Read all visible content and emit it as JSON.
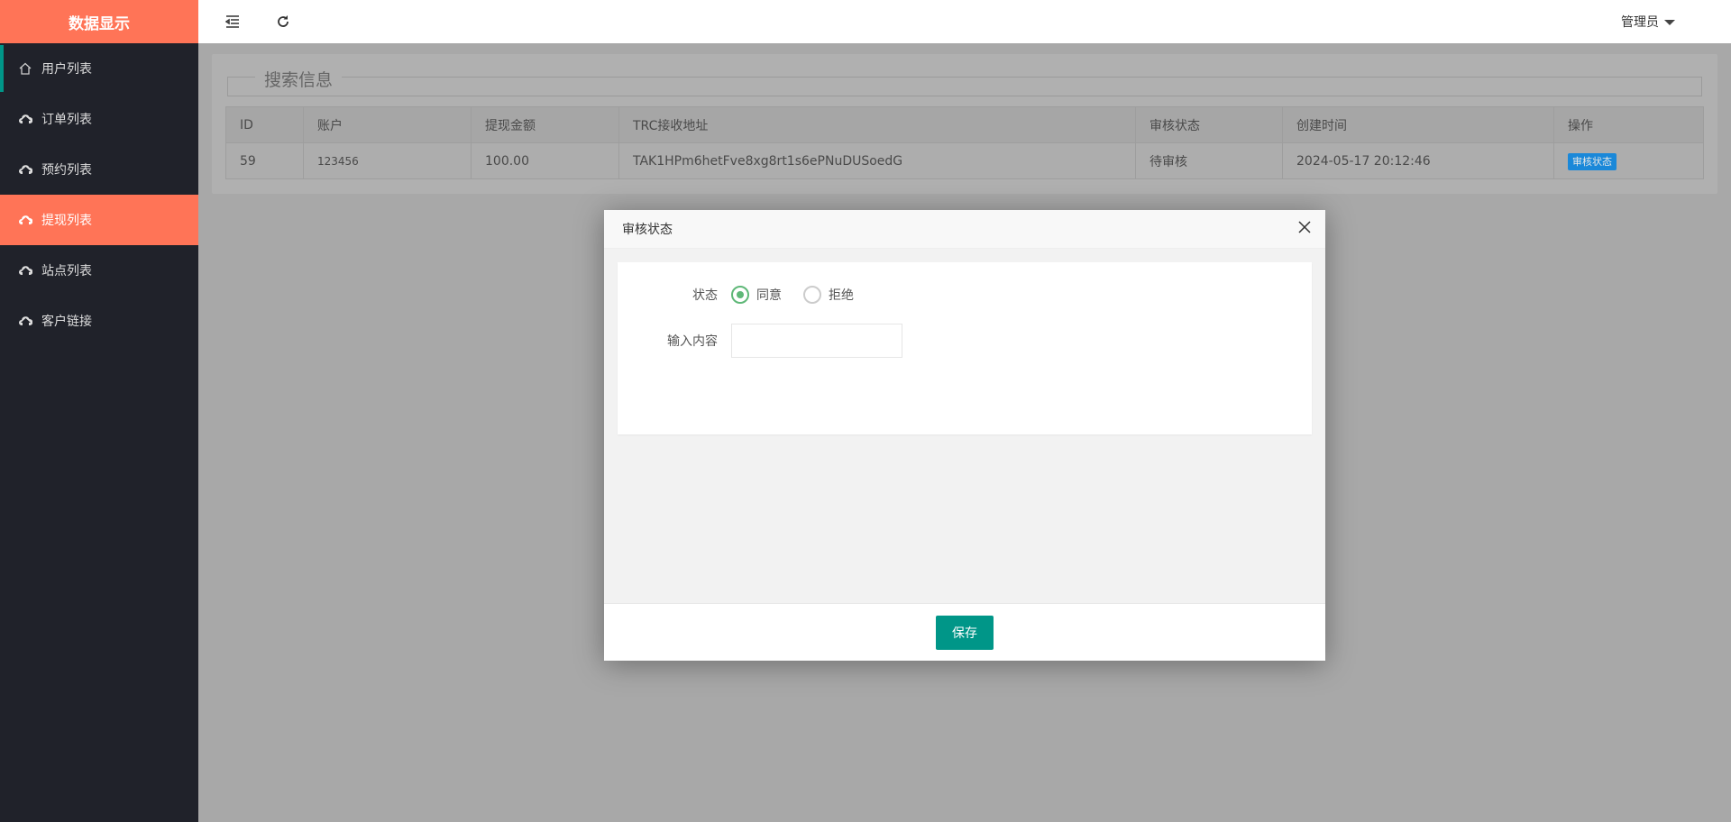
{
  "sidebar": {
    "logo": "数据显示",
    "items": [
      {
        "label": "用户列表",
        "icon": "home-icon"
      },
      {
        "label": "订单列表",
        "icon": "cloud-upload-icon"
      },
      {
        "label": "预约列表",
        "icon": "cloud-upload-icon"
      },
      {
        "label": "提现列表",
        "icon": "cloud-upload-icon",
        "active": true
      },
      {
        "label": "站点列表",
        "icon": "cloud-upload-icon"
      },
      {
        "label": "客户链接",
        "icon": "cloud-upload-icon"
      }
    ]
  },
  "topbar": {
    "user": "管理员"
  },
  "panel": {
    "legend": "搜索信息",
    "columns": [
      "ID",
      "账户",
      "提现金额",
      "TRC接收地址",
      "审核状态",
      "创建时间",
      "操作"
    ],
    "rows": [
      {
        "id": "59",
        "account": "123456",
        "amount": "100.00",
        "address": "TAK1HPm6hetFve8xg8rt1s6ePNuDUSoedG",
        "status": "待审核",
        "created": "2024-05-17 20:12:46",
        "action": "审核状态"
      }
    ]
  },
  "modal": {
    "title": "审核状态",
    "status_label": "状态",
    "options": [
      "同意",
      "拒绝"
    ],
    "selected": "同意",
    "content_label": "输入内容",
    "content_value": "",
    "save": "保存"
  },
  "colors": {
    "brand": "#ff7457",
    "sidebar": "#20222a",
    "primary": "#009688",
    "radio": "#5fb878"
  }
}
